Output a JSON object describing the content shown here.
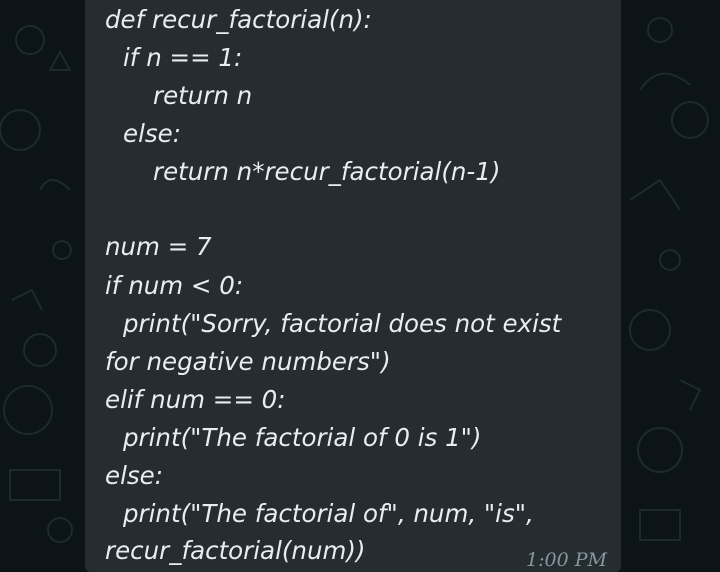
{
  "message": {
    "code_lines": [
      "def recur_factorial(n):",
      "if n == 1:",
      "return n",
      "else:",
      "return n*recur_factorial(n-1)",
      "",
      "num = 7",
      "if num < 0:",
      "print(\"Sorry, factorial does not exist",
      "for negative numbers\")",
      "elif num == 0:",
      "print(\"The factorial of 0 is 1\")",
      "else:",
      "print(\"The factorial of\", num, \"is\",",
      "recur_factorial(num))"
    ],
    "timestamp": "1:00 PM"
  },
  "colors": {
    "chat_background": "#0d1418",
    "bubble_background": "#262d31",
    "text": "#e9edef",
    "timestamp": "#8696a0"
  }
}
